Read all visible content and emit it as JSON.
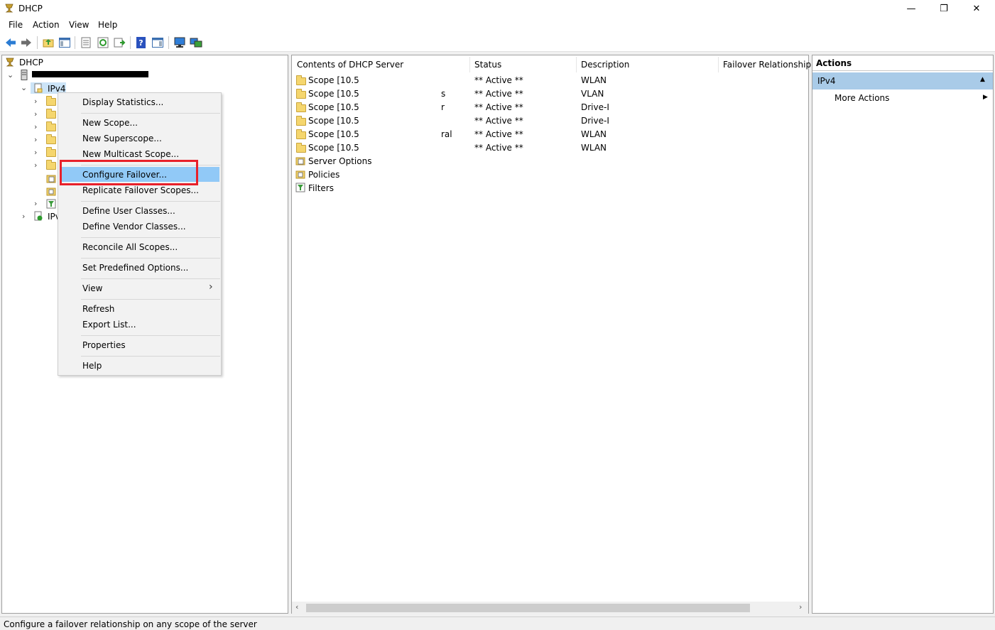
{
  "window": {
    "title": "DHCP",
    "minimize": "—",
    "restore": "❐",
    "close": "✕"
  },
  "menu": [
    "File",
    "Action",
    "View",
    "Help"
  ],
  "tree": {
    "root": "DHCP",
    "ipv4": "IPv4",
    "ipv6": "IPv"
  },
  "context_menu": {
    "display_statistics": "Display Statistics...",
    "new_scope": "New Scope...",
    "new_superscope": "New Superscope...",
    "new_multicast_scope": "New Multicast Scope...",
    "configure_failover": "Configure Failover...",
    "replicate_failover_scopes": "Replicate Failover Scopes...",
    "define_user_classes": "Define User Classes...",
    "define_vendor_classes": "Define Vendor Classes...",
    "reconcile_all_scopes": "Reconcile All Scopes...",
    "set_predefined_options": "Set Predefined Options...",
    "view": "View",
    "view_arrow": "›",
    "refresh": "Refresh",
    "export_list": "Export List...",
    "properties": "Properties",
    "help": "Help"
  },
  "content": {
    "columns": [
      "Contents of DHCP Server",
      "Status",
      "Description",
      "Failover Relationship"
    ],
    "rows": [
      {
        "name": "Scope [10.5",
        "frag": "",
        "status": "** Active **",
        "desc": "WLAN"
      },
      {
        "name": "Scope [10.5",
        "frag": "s",
        "status": "** Active **",
        "desc": "VLAN"
      },
      {
        "name": "Scope [10.5",
        "frag": "r",
        "status": "** Active **",
        "desc": "Drive-I"
      },
      {
        "name": "Scope [10.5",
        "frag": "",
        "status": "** Active **",
        "desc": "Drive-I"
      },
      {
        "name": "Scope [10.5",
        "frag": "ral",
        "status": "** Active **",
        "desc": "WLAN"
      },
      {
        "name": "Scope [10.5",
        "frag": "",
        "status": "** Active **",
        "desc": "WLAN"
      }
    ],
    "items": [
      "Server Options",
      "Policies",
      "Filters"
    ]
  },
  "actions": {
    "header": "Actions",
    "section": "IPv4",
    "section_arrow": "▲",
    "more_actions": "More Actions",
    "more_arrow": "▶"
  },
  "status_bar": "Configure a failover relationship on any scope of the server",
  "colors": {
    "highlight": "#91c9f7",
    "annotation_box": "#e8202a",
    "actions_selected": "#a9cbe8"
  }
}
